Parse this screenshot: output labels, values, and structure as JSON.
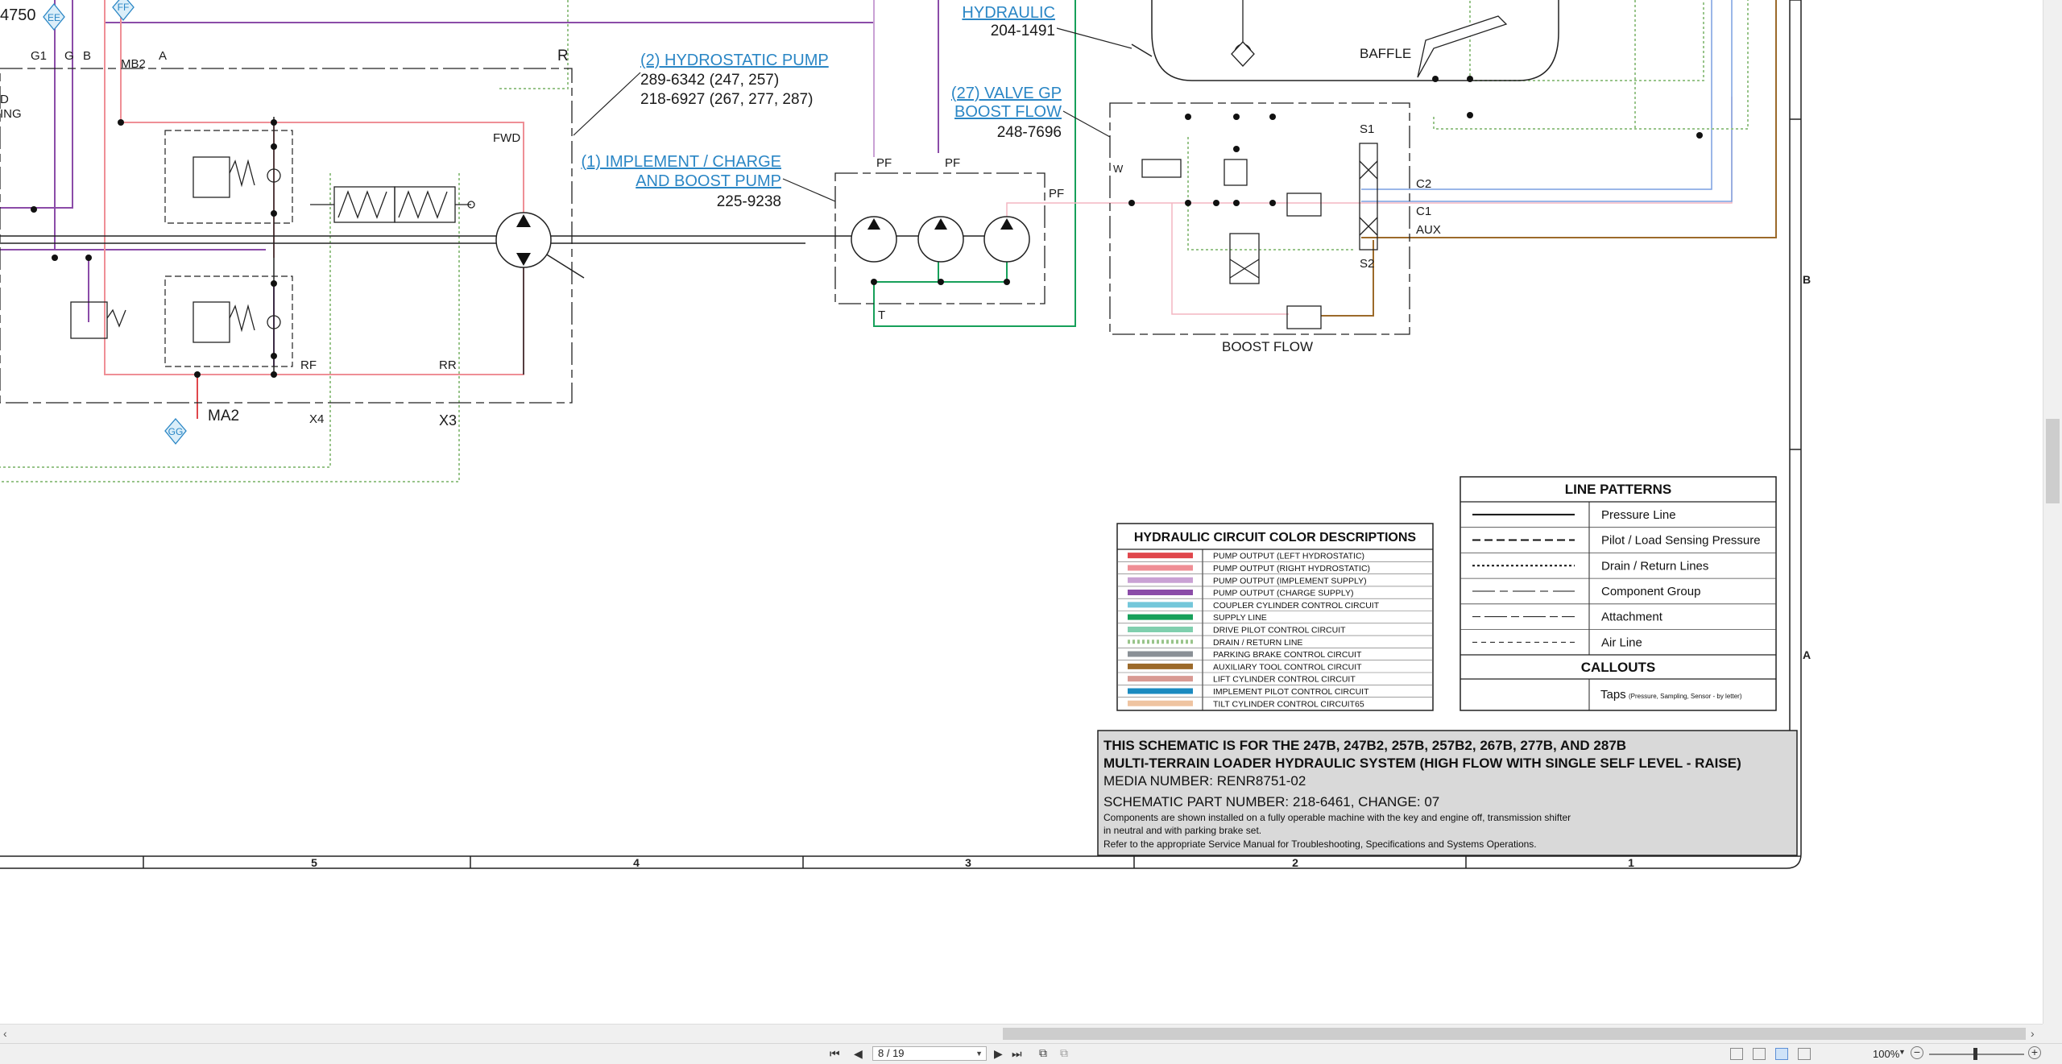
{
  "schematic": {
    "partial_top_label": "4750",
    "hydraulic_link": {
      "label": "HYDRAULIC",
      "part": "204-1491"
    },
    "hydrostatic_pump": {
      "label": "(2) HYDROSTATIC PUMP",
      "part1": "289-6342 (247, 257)",
      "part2": "218-6927 (267, 277, 287)"
    },
    "implement_pump": {
      "label_line1": "(1) IMPLEMENT / CHARGE",
      "label_line2": "AND BOOST PUMP",
      "part": "225-9238"
    },
    "valve_gp": {
      "label_line1": "(27) VALVE GP",
      "label_line2": "BOOST FLOW",
      "part": "248-7696"
    },
    "labels": {
      "baffle": "BAFFLE",
      "g1": "G1",
      "g": "G",
      "b": "B",
      "a": "A",
      "mb2": "MB2",
      "r": "R",
      "fwd": "FWD",
      "rf": "RF",
      "rr": "RR",
      "x4": "X4",
      "x3": "X3",
      "ma2": "MA2",
      "pf1": "PF",
      "pf2": "PF",
      "pf3": "PF",
      "t": "T",
      "s1": "S1",
      "s2": "S2",
      "c2": "C2",
      "c1": "C1",
      "aux": "AUX",
      "boost_flow": "BOOST FLOW",
      "partial_d": "D",
      "partial_ing": "ING",
      "w": "W"
    },
    "taps": {
      "ee": "EE",
      "ff": "FF",
      "gg": "GG"
    },
    "border_letters": {
      "b": "B",
      "a": "A"
    },
    "column_numbers": [
      "5",
      "4",
      "3",
      "2",
      "1"
    ]
  },
  "color_table": {
    "title": "HYDRAULIC CIRCUIT COLOR DESCRIPTIONS",
    "rows": [
      {
        "label": "PUMP OUTPUT (LEFT HYDROSTATIC)",
        "color": "#e0474c",
        "dotted": false
      },
      {
        "label": "PUMP OUTPUT (RIGHT HYDROSTATIC)",
        "color": "#ef8f96",
        "dotted": false
      },
      {
        "label": "PUMP OUTPUT (IMPLEMENT SUPPLY)",
        "color": "#c9a1d4",
        "dotted": false
      },
      {
        "label": "PUMP OUTPUT (CHARGE SUPPLY)",
        "color": "#8b4ca8",
        "dotted": false
      },
      {
        "label": "COUPLER CYLINDER CONTROL CIRCUIT",
        "color": "#74c7da",
        "dotted": false
      },
      {
        "label": "SUPPLY LINE",
        "color": "#17a05a",
        "dotted": false
      },
      {
        "label": "DRIVE PILOT CONTROL CIRCUIT",
        "color": "#7fcfae",
        "dotted": false
      },
      {
        "label": "DRAIN / RETURN LINE",
        "color": "#98c48a",
        "dotted": true
      },
      {
        "label": "PARKING BRAKE CONTROL CIRCUIT",
        "color": "#8a9096",
        "dotted": false
      },
      {
        "label": "AUXILIARY TOOL CONTROL CIRCUIT",
        "color": "#9c6a2a",
        "dotted": false
      },
      {
        "label": "LIFT CYLINDER CONTROL CIRCUIT",
        "color": "#d89a93",
        "dotted": false
      },
      {
        "label": "IMPLEMENT PILOT CONTROL CIRCUIT",
        "color": "#1a8ac0",
        "dotted": false
      },
      {
        "label": "TILT CYLINDER CONTROL CIRCUIT65",
        "color": "#efc4a1",
        "dotted": false
      }
    ]
  },
  "line_patterns": {
    "title": "LINE PATTERNS",
    "rows": [
      {
        "label": "Pressure Line",
        "dash": "none",
        "width": 2
      },
      {
        "label": "Pilot / Load Sensing Pressure",
        "dash": "10,5",
        "width": 2
      },
      {
        "label": "Drain / Return Lines",
        "dash": "3,3",
        "width": 2
      },
      {
        "label": "Component Group",
        "dash": "28,6,10,6",
        "width": 1
      },
      {
        "label": "Attachment",
        "dash": "10,5,28,5",
        "width": 1
      },
      {
        "label": "Air Line",
        "dash": "6,5",
        "width": 1
      }
    ],
    "callouts_title": "CALLOUTS",
    "taps_label": "Taps",
    "taps_note": "(Pressure, Sampling, Sensor - by letter)"
  },
  "title_block": {
    "line1": "THIS SCHEMATIC IS FOR THE 247B, 247B2, 257B, 257B2, 267B, 277B, AND 287B",
    "line2": "MULTI-TERRAIN LOADER HYDRAULIC SYSTEM (HIGH FLOW WITH SINGLE SELF LEVEL - RAISE)",
    "media": "MEDIA NUMBER: RENR8751-02",
    "part": "SCHEMATIC PART NUMBER: 218-6461, CHANGE: 07",
    "note1": "Components are shown installed on a fully operable machine with the key and engine off, transmission shifter",
    "note2": "in neutral and with parking brake set.",
    "note3": "Refer to the appropriate Service Manual for Troubleshooting, Specifications and Systems Operations."
  },
  "statusbar": {
    "page_value": "8 / 19",
    "zoom": "100%"
  }
}
